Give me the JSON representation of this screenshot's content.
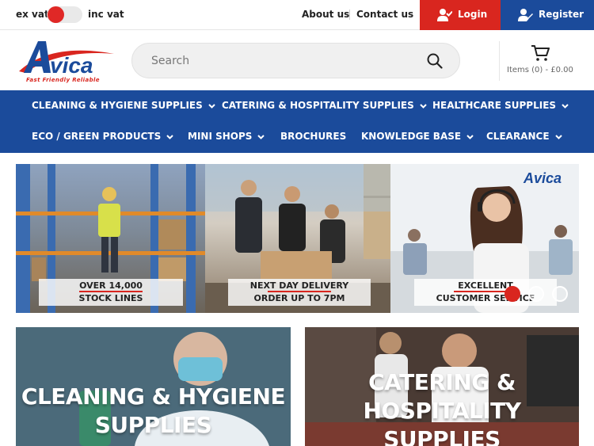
{
  "vat": {
    "ex_label": "ex vat",
    "inc_label": "inc vat",
    "accent": "#e02826"
  },
  "top_links": {
    "about": "About us",
    "contact": "Contact us"
  },
  "account": {
    "login": "Login",
    "register": "Register",
    "login_color": "#d9261f",
    "register_color": "#1b4b9b"
  },
  "brand": {
    "name": "Avica",
    "tagline": "Fast Friendly Reliable"
  },
  "search": {
    "placeholder": "Search",
    "value": ""
  },
  "cart": {
    "summary": "Items (0) - £0.00"
  },
  "nav": {
    "color": "#1b4b9b",
    "row1": [
      {
        "label": "CLEANING & HYGIENE SUPPLIES",
        "dropdown": true
      },
      {
        "label": "CATERING & HOSPITALITY SUPPLIES",
        "dropdown": true
      },
      {
        "label": "HEALTHCARE SUPPLIES",
        "dropdown": true
      }
    ],
    "row2": [
      {
        "label": "ECO / GREEN PRODUCTS",
        "dropdown": true
      },
      {
        "label": "MINI SHOPS",
        "dropdown": true
      },
      {
        "label": "BROCHURES",
        "dropdown": false
      },
      {
        "label": "KNOWLEDGE BASE",
        "dropdown": true
      },
      {
        "label": "CLEARANCE",
        "dropdown": true
      }
    ]
  },
  "hero": {
    "slides": [
      {
        "line1": "OVER 14,000",
        "line2": "STOCK LINES"
      },
      {
        "line1": "NEXT DAY DELIVERY",
        "line2": "ORDER UP TO 7PM"
      },
      {
        "line1": "EXCELLENT",
        "line2": "CUSTOMER SERVICE"
      }
    ],
    "dots": 3,
    "active_dot": 1
  },
  "categories": [
    {
      "line1": "CLEANING & HYGIENE",
      "line2": "SUPPLIES"
    },
    {
      "line1": "CATERING &",
      "line2": "HOSPITALITY",
      "line3": "SUPPLIES"
    }
  ]
}
